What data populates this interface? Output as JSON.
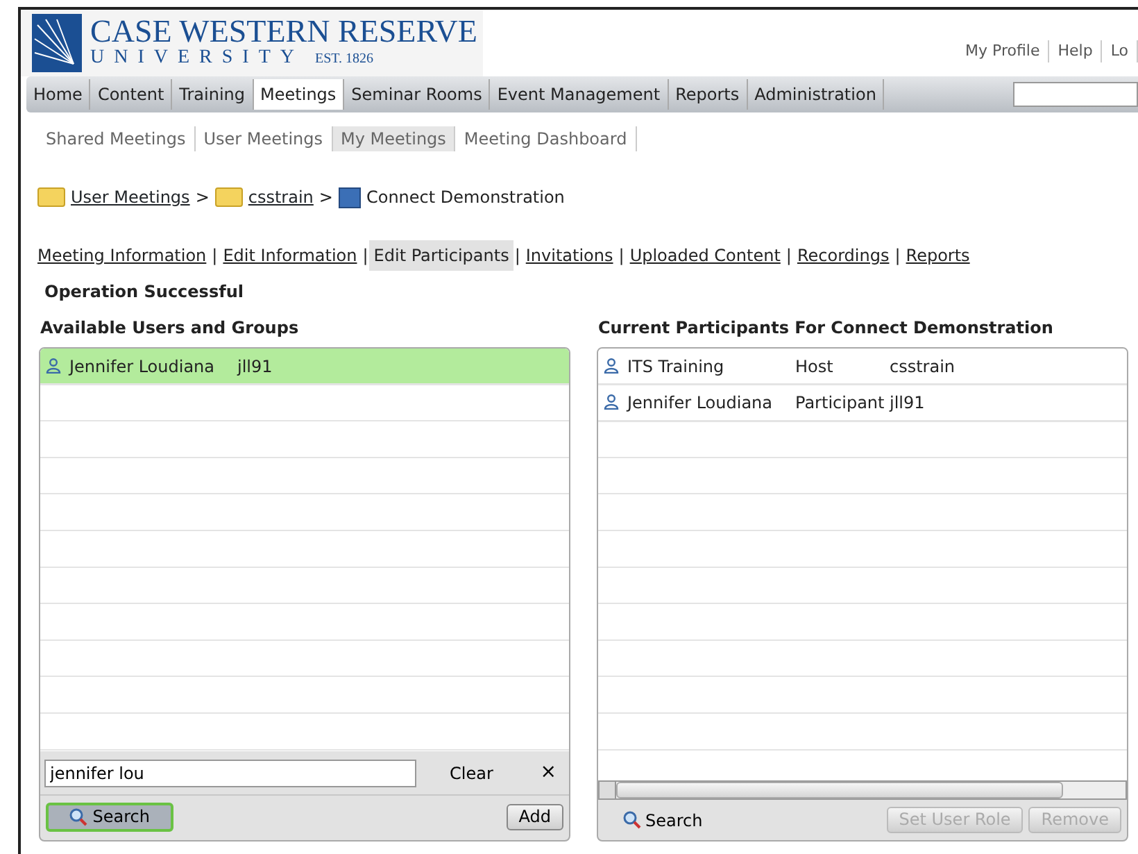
{
  "logo": {
    "name": "CASE WESTERN RESERVE",
    "sub": "UNIVERSITY",
    "est": "EST. 1826"
  },
  "top_links": [
    "My Profile",
    "Help",
    "Lo"
  ],
  "nav": [
    {
      "label": "Home",
      "selected": false
    },
    {
      "label": "Content",
      "selected": false
    },
    {
      "label": "Training",
      "selected": false
    },
    {
      "label": "Meetings",
      "selected": true
    },
    {
      "label": "Seminar Rooms",
      "selected": false
    },
    {
      "label": "Event Management",
      "selected": false
    },
    {
      "label": "Reports",
      "selected": false
    },
    {
      "label": "Administration",
      "selected": false
    }
  ],
  "subnav": [
    {
      "label": "Shared Meetings",
      "selected": false
    },
    {
      "label": "User Meetings",
      "selected": false
    },
    {
      "label": "My Meetings",
      "selected": true
    },
    {
      "label": "Meeting Dashboard",
      "selected": false
    }
  ],
  "breadcrumb": [
    {
      "label": "User Meetings",
      "kind": "folder"
    },
    {
      "label": "csstrain",
      "kind": "folder"
    },
    {
      "label": "Connect Demonstration",
      "kind": "meeting"
    }
  ],
  "breadcrumb_separator": ">",
  "tabs": [
    {
      "label": "Meeting Information",
      "selected": false
    },
    {
      "label": "Edit Information",
      "selected": false
    },
    {
      "label": "Edit Participants",
      "selected": true
    },
    {
      "label": "Invitations",
      "selected": false
    },
    {
      "label": "Uploaded Content",
      "selected": false
    },
    {
      "label": "Recordings",
      "selected": false
    },
    {
      "label": "Reports",
      "selected": false
    }
  ],
  "tab_separator": "|",
  "status": "Operation Successful",
  "available": {
    "title": "Available Users and Groups",
    "rows": [
      {
        "name": "Jennifer Loudiana",
        "login": "jll91",
        "selected": true
      }
    ],
    "search_value": "jennifer lou",
    "clear": "Clear",
    "close": "×",
    "search_button": "Search",
    "add_button": "Add"
  },
  "current": {
    "title": "Current Participants For Connect Demonstration",
    "rows": [
      {
        "name": "ITS Training",
        "role": "Host",
        "login": "csstrain"
      },
      {
        "name": "Jennifer Loudiana",
        "role": "Participant",
        "login": "jll91"
      }
    ],
    "search_button": "Search",
    "buttons": [
      {
        "label": "Set User Role",
        "disabled": true
      },
      {
        "label": "Remove",
        "disabled": true
      }
    ]
  }
}
